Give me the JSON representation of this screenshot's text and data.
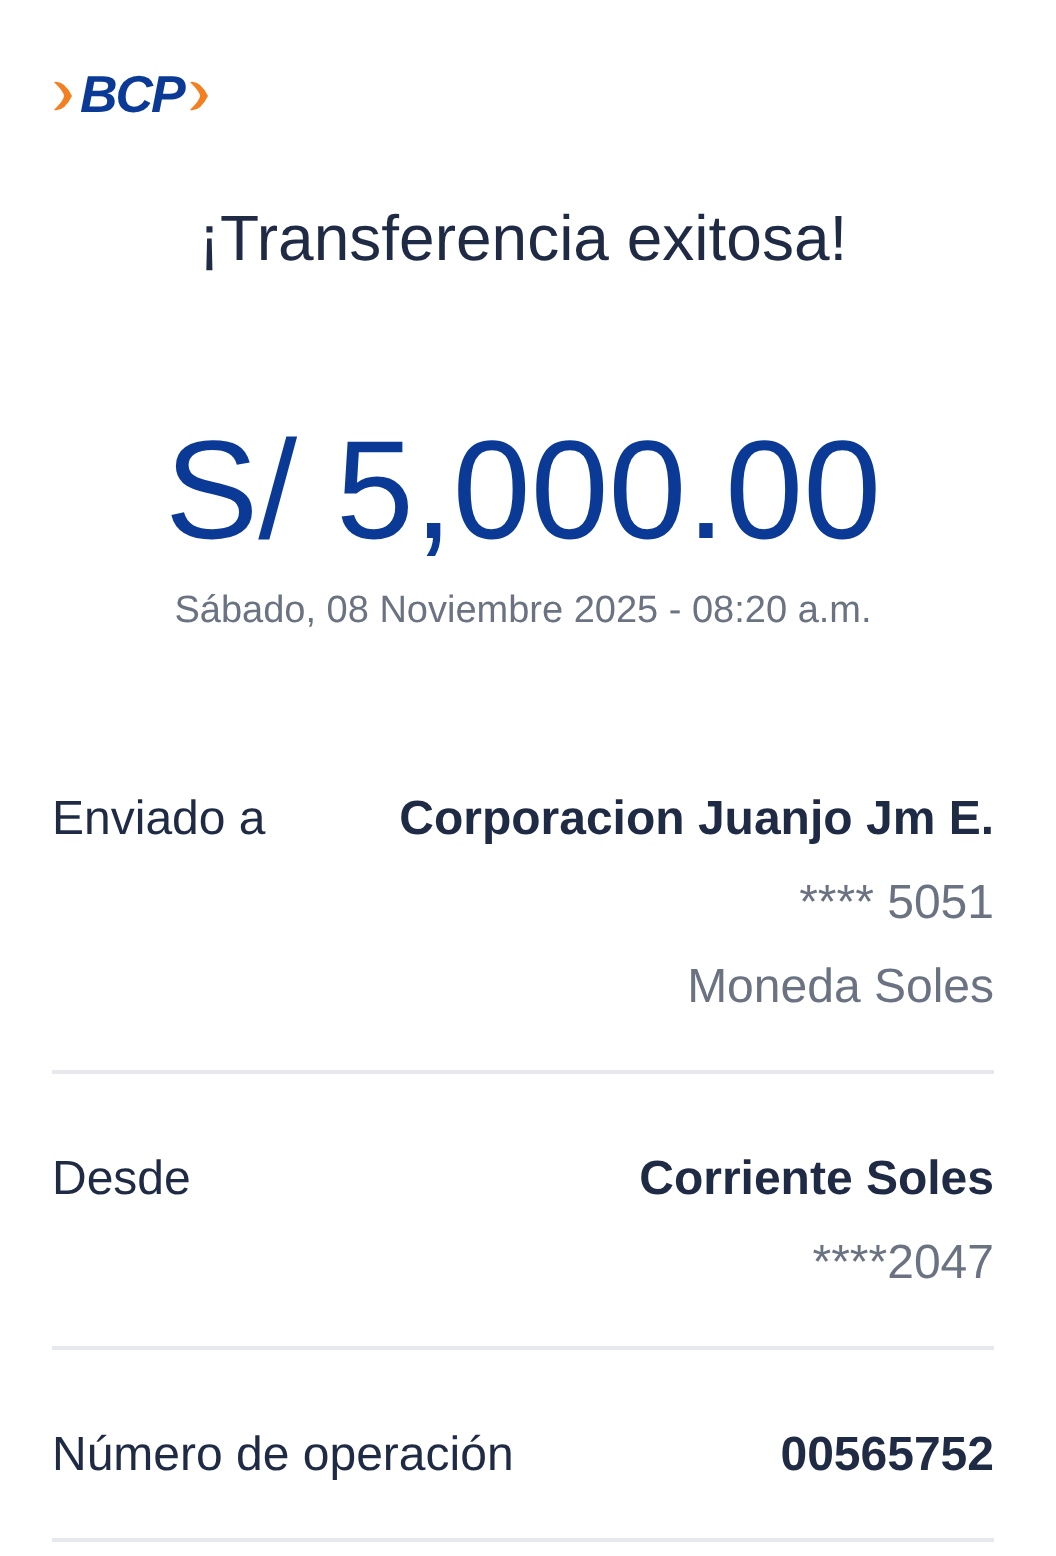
{
  "logo": {
    "text": "BCP"
  },
  "title": "¡Transferencia exitosa!",
  "amount": "S/ 5,000.00",
  "datetime": "Sábado, 08 Noviembre 2025 - 08:20 a.m.",
  "details": [
    {
      "label": "Enviado a",
      "lines": [
        "Corporacion Juanjo Jm E.",
        "**** 5051",
        "Moneda Soles"
      ]
    },
    {
      "label": "Desde",
      "lines": [
        "Corriente Soles",
        "****2047"
      ]
    },
    {
      "label": "Número de operación",
      "lines": [
        "00565752"
      ]
    }
  ]
}
